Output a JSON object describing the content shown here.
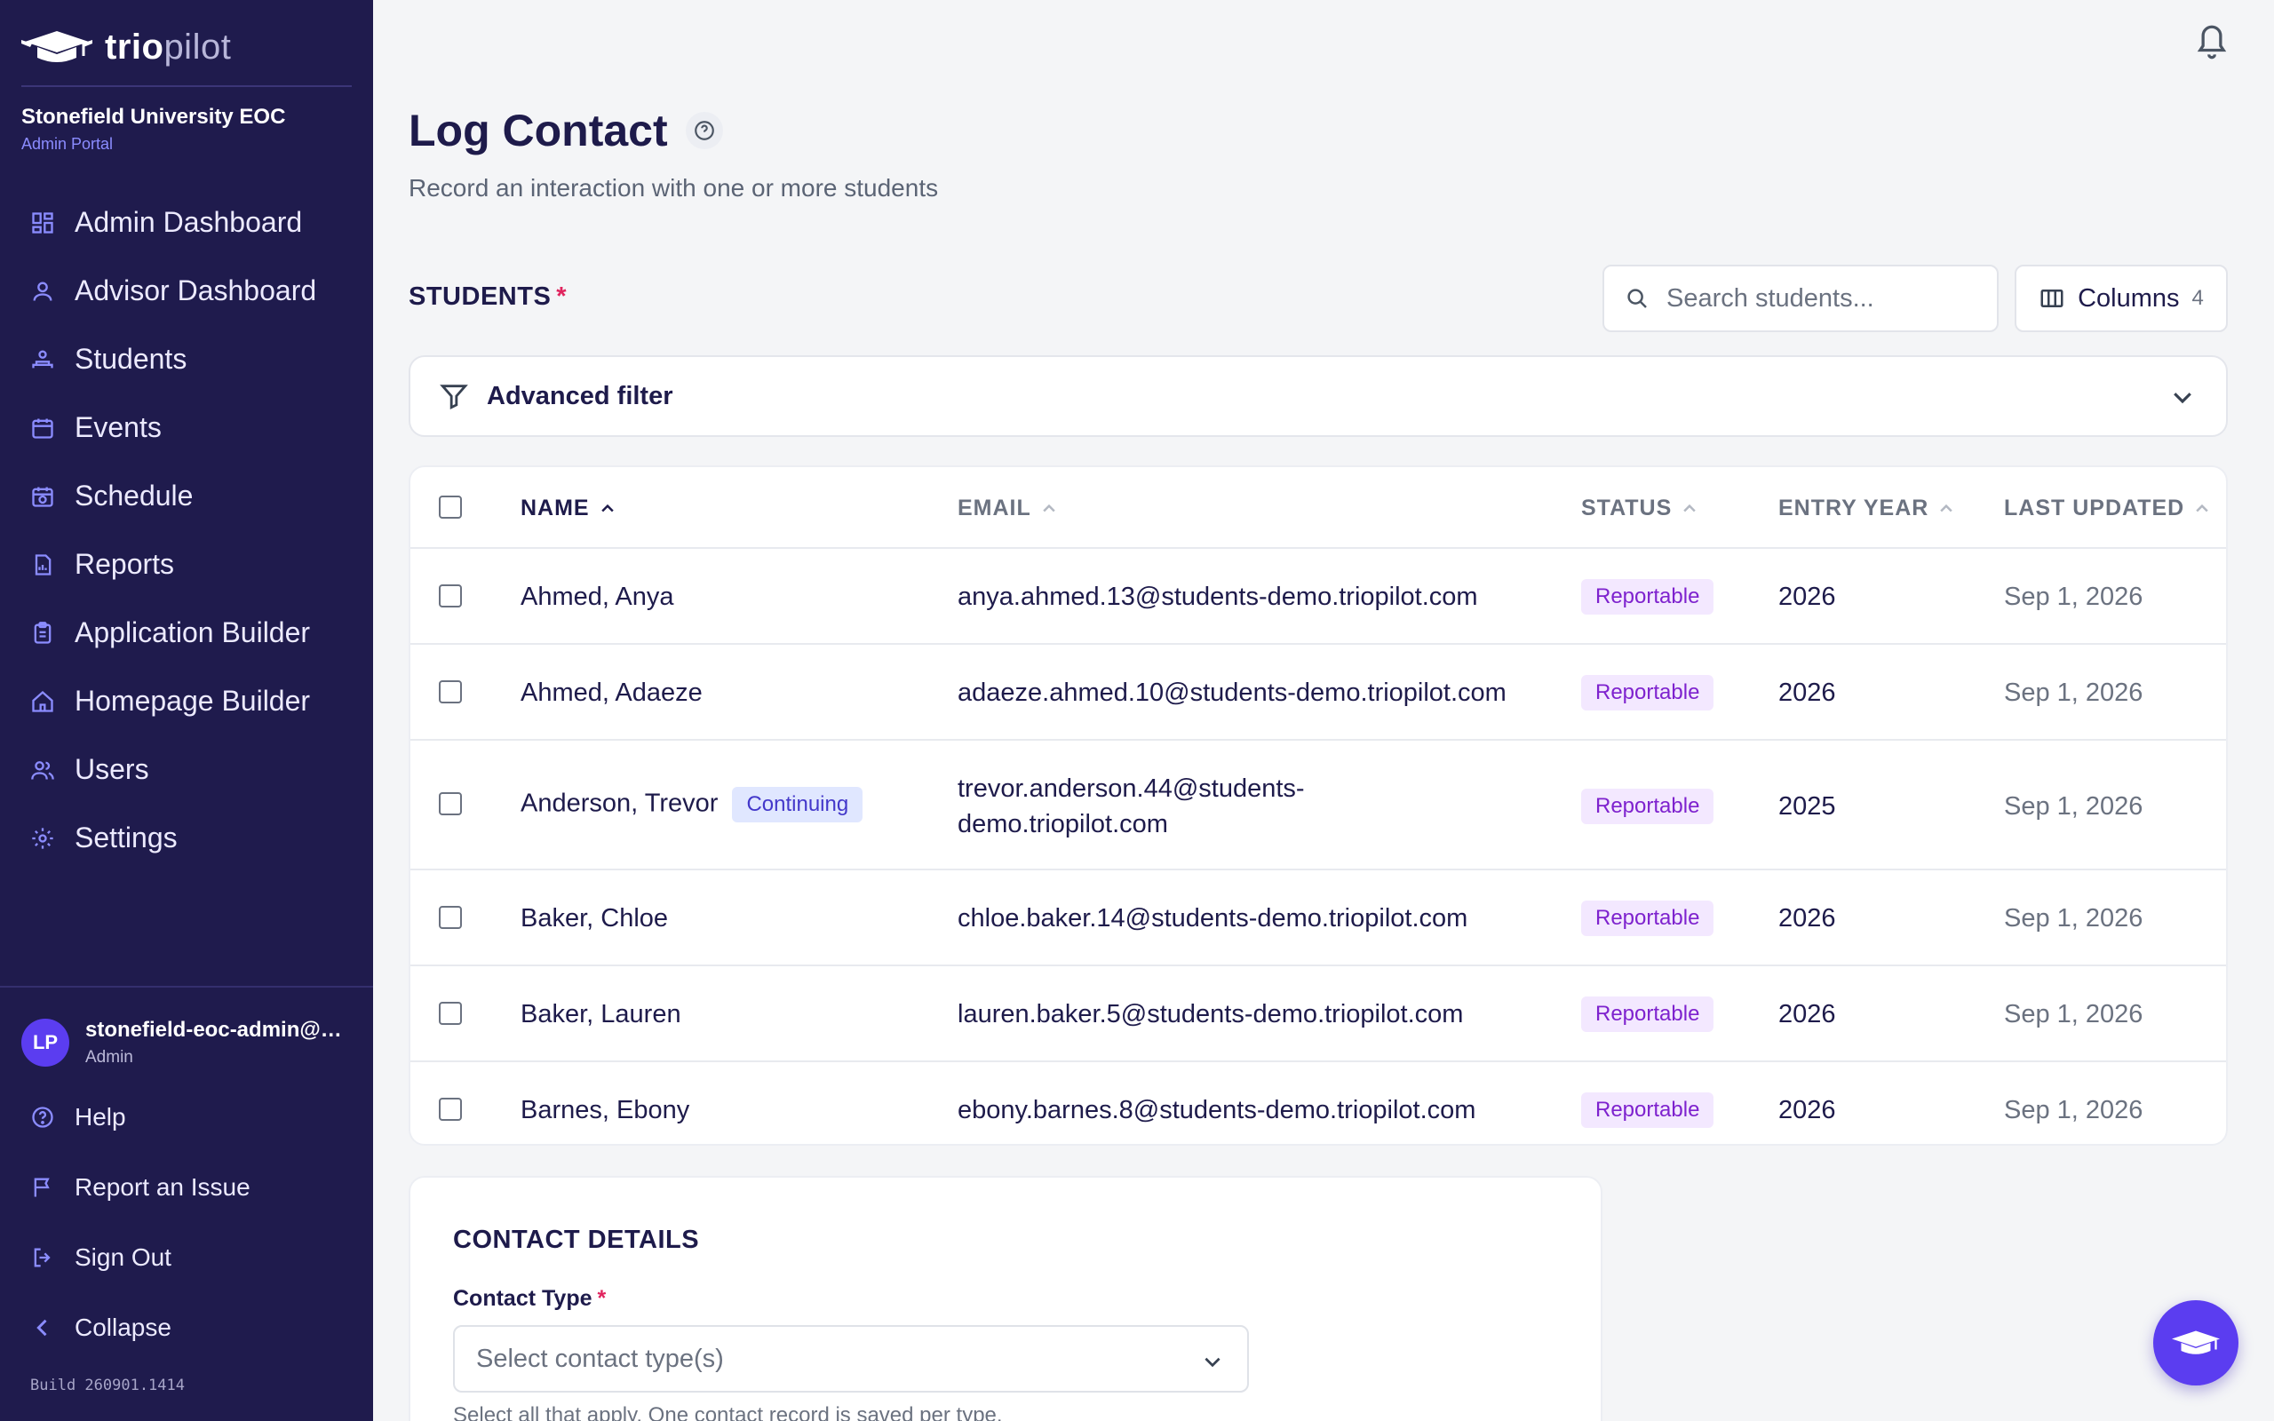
{
  "brand": {
    "name_part1": "trio",
    "name_part2": "pilot"
  },
  "org": {
    "name": "Stonefield University EOC",
    "portal": "Admin Portal"
  },
  "nav": [
    {
      "label": "Admin Dashboard",
      "icon": "dashboard-icon"
    },
    {
      "label": "Advisor Dashboard",
      "icon": "person-icon"
    },
    {
      "label": "Students",
      "icon": "students-icon"
    },
    {
      "label": "Events",
      "icon": "calendar-icon"
    },
    {
      "label": "Schedule",
      "icon": "schedule-icon"
    },
    {
      "label": "Reports",
      "icon": "report-icon"
    },
    {
      "label": "Application Builder",
      "icon": "clipboard-icon"
    },
    {
      "label": "Homepage Builder",
      "icon": "home-icon"
    },
    {
      "label": "Users",
      "icon": "users-icon"
    },
    {
      "label": "Settings",
      "icon": "gear-icon"
    }
  ],
  "user": {
    "initials": "LP",
    "email": "stonefield-eoc-admin@demo.triopilot.com",
    "role": "Admin"
  },
  "footer_nav": [
    {
      "label": "Help",
      "icon": "help-icon"
    },
    {
      "label": "Report an Issue",
      "icon": "flag-icon"
    },
    {
      "label": "Sign Out",
      "icon": "sign-out-icon"
    },
    {
      "label": "Collapse",
      "icon": "chevron-left-icon"
    }
  ],
  "build": "Build 260901.1414",
  "page": {
    "title": "Log Contact",
    "subtitle": "Record an interaction with one or more students"
  },
  "students_section": {
    "label": "STUDENTS",
    "required_mark": "*",
    "search_placeholder": "Search students...",
    "columns_label": "Columns",
    "columns_count": "4",
    "filter_label": "Advanced filter"
  },
  "table": {
    "headers": {
      "name": "NAME",
      "email": "EMAIL",
      "status": "STATUS",
      "entry_year": "ENTRY YEAR",
      "last_updated": "LAST UPDATED"
    },
    "rows": [
      {
        "name": "Ahmed, Anya",
        "tag": "",
        "email": "anya.ahmed.13@students-demo.triopilot.com",
        "email_line2": "",
        "status": "Reportable",
        "entry_year": "2026",
        "last_updated": "Sep 1, 2026"
      },
      {
        "name": "Ahmed, Adaeze",
        "tag": "",
        "email": "adaeze.ahmed.10@students-demo.triopilot.com",
        "email_line2": "",
        "status": "Reportable",
        "entry_year": "2026",
        "last_updated": "Sep 1, 2026"
      },
      {
        "name": "Anderson, Trevor",
        "tag": "Continuing",
        "email": "trevor.anderson.44@students-",
        "email_line2": "demo.triopilot.com",
        "status": "Reportable",
        "entry_year": "2025",
        "last_updated": "Sep 1, 2026"
      },
      {
        "name": "Baker, Chloe",
        "tag": "",
        "email": "chloe.baker.14@students-demo.triopilot.com",
        "email_line2": "",
        "status": "Reportable",
        "entry_year": "2026",
        "last_updated": "Sep 1, 2026"
      },
      {
        "name": "Baker, Lauren",
        "tag": "",
        "email": "lauren.baker.5@students-demo.triopilot.com",
        "email_line2": "",
        "status": "Reportable",
        "entry_year": "2026",
        "last_updated": "Sep 1, 2026"
      },
      {
        "name": "Barnes, Ebony",
        "tag": "",
        "email": "ebony.barnes.8@students-demo.triopilot.com",
        "email_line2": "",
        "status": "Reportable",
        "entry_year": "2026",
        "last_updated": "Sep 1, 2026"
      }
    ]
  },
  "contact_details": {
    "title": "CONTACT DETAILS",
    "contact_type_label": "Contact Type",
    "required_mark": "*",
    "select_placeholder": "Select contact type(s)",
    "help_text": "Select all that apply. One contact record is saved per type."
  },
  "colors": {
    "sidebar_bg": "#1f1b4d",
    "accent": "#5b3df0",
    "status_badge_bg": "#f3e8ff",
    "status_badge_text": "#7e22ce",
    "required": "#e0245e"
  }
}
